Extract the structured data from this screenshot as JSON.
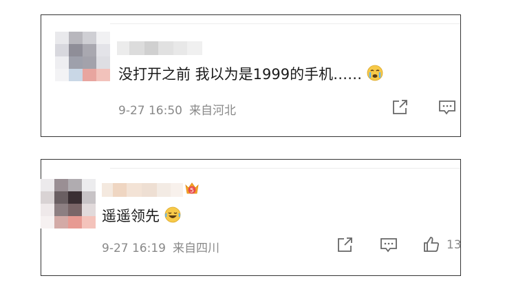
{
  "comments": [
    {
      "text": "没打开之前 我以为是1999的手机……",
      "emoji": "crying-face",
      "time": "9-27 16:50",
      "location": "来自河北"
    },
    {
      "text": "遥遥领先",
      "emoji": "tears-of-joy-face",
      "time": "9-27 16:19",
      "location": "来自四川",
      "like_count": "13",
      "badge": "5"
    }
  ],
  "colors": {
    "meta": "#888888",
    "text": "#1a1a1a",
    "icon": "#666666"
  }
}
